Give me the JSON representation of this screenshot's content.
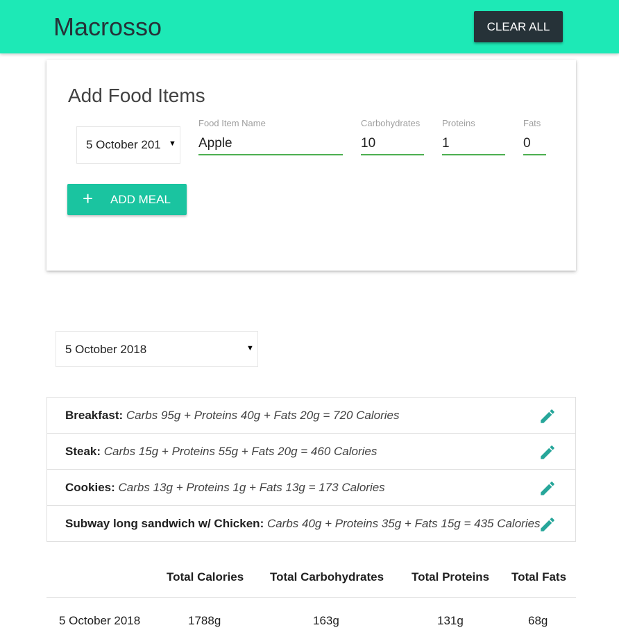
{
  "navbar": {
    "brand": "Macrosso",
    "clear_label": "CLEAR ALL",
    "background": "#1de9b6"
  },
  "add_form": {
    "title": "Add Food Items",
    "date_value": "5 October 201",
    "fields": {
      "name": {
        "label": "Food Item Name",
        "value": "Apple"
      },
      "carbs": {
        "label": "Carbohydrates",
        "value": "10"
      },
      "proteins": {
        "label": "Proteins",
        "value": "1"
      },
      "fats": {
        "label": "Fats",
        "value": "0"
      }
    },
    "add_label": "ADD MEAL",
    "add_icon": "plus-icon"
  },
  "date_filter": {
    "value": "5 October 2018"
  },
  "meals": [
    {
      "name": "Breakfast",
      "detail": "Carbs 95g + Proteins 40g + Fats 20g = 720 Calories",
      "icon": "pencil-icon"
    },
    {
      "name": "Steak",
      "detail": "Carbs 15g + Proteins 55g + Fats 20g = 460 Calories",
      "icon": "pencil-icon"
    },
    {
      "name": "Cookies",
      "detail": "Carbs 13g + Proteins 1g + Fats 13g = 173 Calories",
      "icon": "pencil-icon"
    },
    {
      "name": "Subway long sandwich w/ Chicken",
      "detail": "Carbs 40g + Proteins 35g + Fats 15g = 435 Calories",
      "icon": "pencil-icon"
    }
  ],
  "totals": {
    "headers": [
      "Total Calories",
      "Total Carbohydrates",
      "Total Proteins",
      "Total Fats"
    ],
    "row": {
      "date": "5 October 2018",
      "calories": "1788g",
      "carbs": "163g",
      "proteins": "131g",
      "fats": "68g"
    }
  },
  "colors": {
    "accent": "#1de9b6",
    "button_teal": "#1ac4a0",
    "dark": "#263238",
    "underline": "#4caf50",
    "icon_teal": "#26a69a"
  }
}
